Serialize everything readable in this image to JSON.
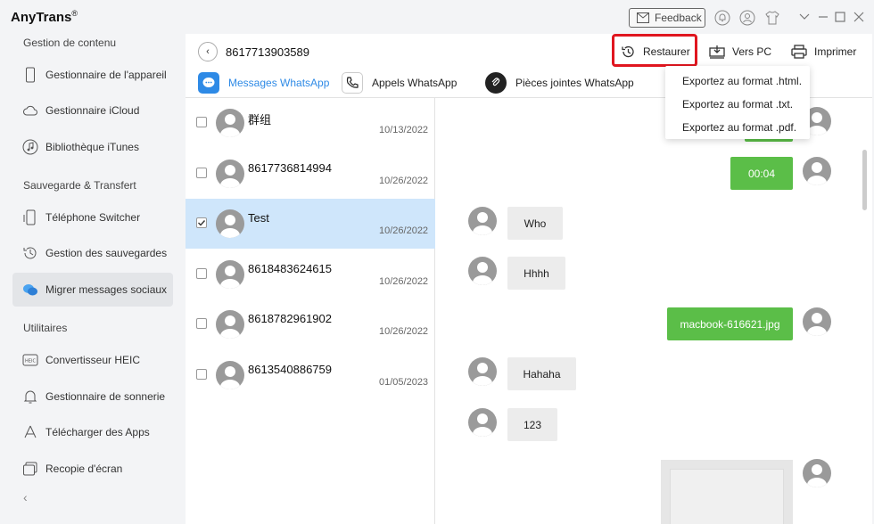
{
  "app": {
    "title": "AnyTrans",
    "reg": "®"
  },
  "titlebar": {
    "feedback_label": "Feedback"
  },
  "sidebar": {
    "sections": [
      {
        "title": "Gestion de contenu",
        "items": [
          "Gestionnaire de l'appareil",
          "Gestionnaire iCloud",
          "Bibliothèque iTunes"
        ]
      },
      {
        "title": "Sauvegarde & Transfert",
        "items": [
          "Téléphone Switcher",
          "Gestion des sauvegardes",
          "Migrer messages sociaux"
        ]
      },
      {
        "title": "Utilitaires",
        "items": [
          "Convertisseur HEIC",
          "Gestionnaire de sonnerie",
          "Télécharger des Apps",
          "Recopie d'écran"
        ]
      }
    ],
    "active_item": "Migrer messages sociaux"
  },
  "header": {
    "contact": "8617713903589",
    "restore_label": "Restaurer",
    "to_pc_label": "Vers PC",
    "print_label": "Imprimer"
  },
  "tabs": [
    {
      "label": "Messages WhatsApp",
      "active": true
    },
    {
      "label": "Appels WhatsApp",
      "active": false
    },
    {
      "label": "Pièces jointes WhatsApp",
      "active": false
    }
  ],
  "conversations": [
    {
      "name": "群组",
      "date": "10/13/2022",
      "checked": false
    },
    {
      "name": "8617736814994",
      "date": "10/26/2022",
      "checked": false
    },
    {
      "name": "Test",
      "date": "10/26/2022",
      "checked": true
    },
    {
      "name": "8618483624615",
      "date": "10/26/2022",
      "checked": false
    },
    {
      "name": "8618782961902",
      "date": "10/26/2022",
      "checked": false
    },
    {
      "name": "8613540886759",
      "date": "01/05/2023",
      "checked": false
    }
  ],
  "messages": [
    {
      "text": "00:04",
      "dir": "out"
    },
    {
      "text": "Who",
      "dir": "in"
    },
    {
      "text": "Hhhh",
      "dir": "in"
    },
    {
      "text": "macbook-616621.jpg",
      "dir": "out"
    },
    {
      "text": "Hahaha",
      "dir": "in"
    },
    {
      "text": "123",
      "dir": "in"
    }
  ],
  "export_menu": {
    "items": [
      "Exportez au format .html.",
      "Exportez au format .txt.",
      "Exportez au format .pdf."
    ]
  },
  "colors": {
    "accent": "#2e8ae6",
    "outgoing": "#5bbe48",
    "highlight": "#e0161f",
    "selected_row": "#cfe6fb"
  }
}
